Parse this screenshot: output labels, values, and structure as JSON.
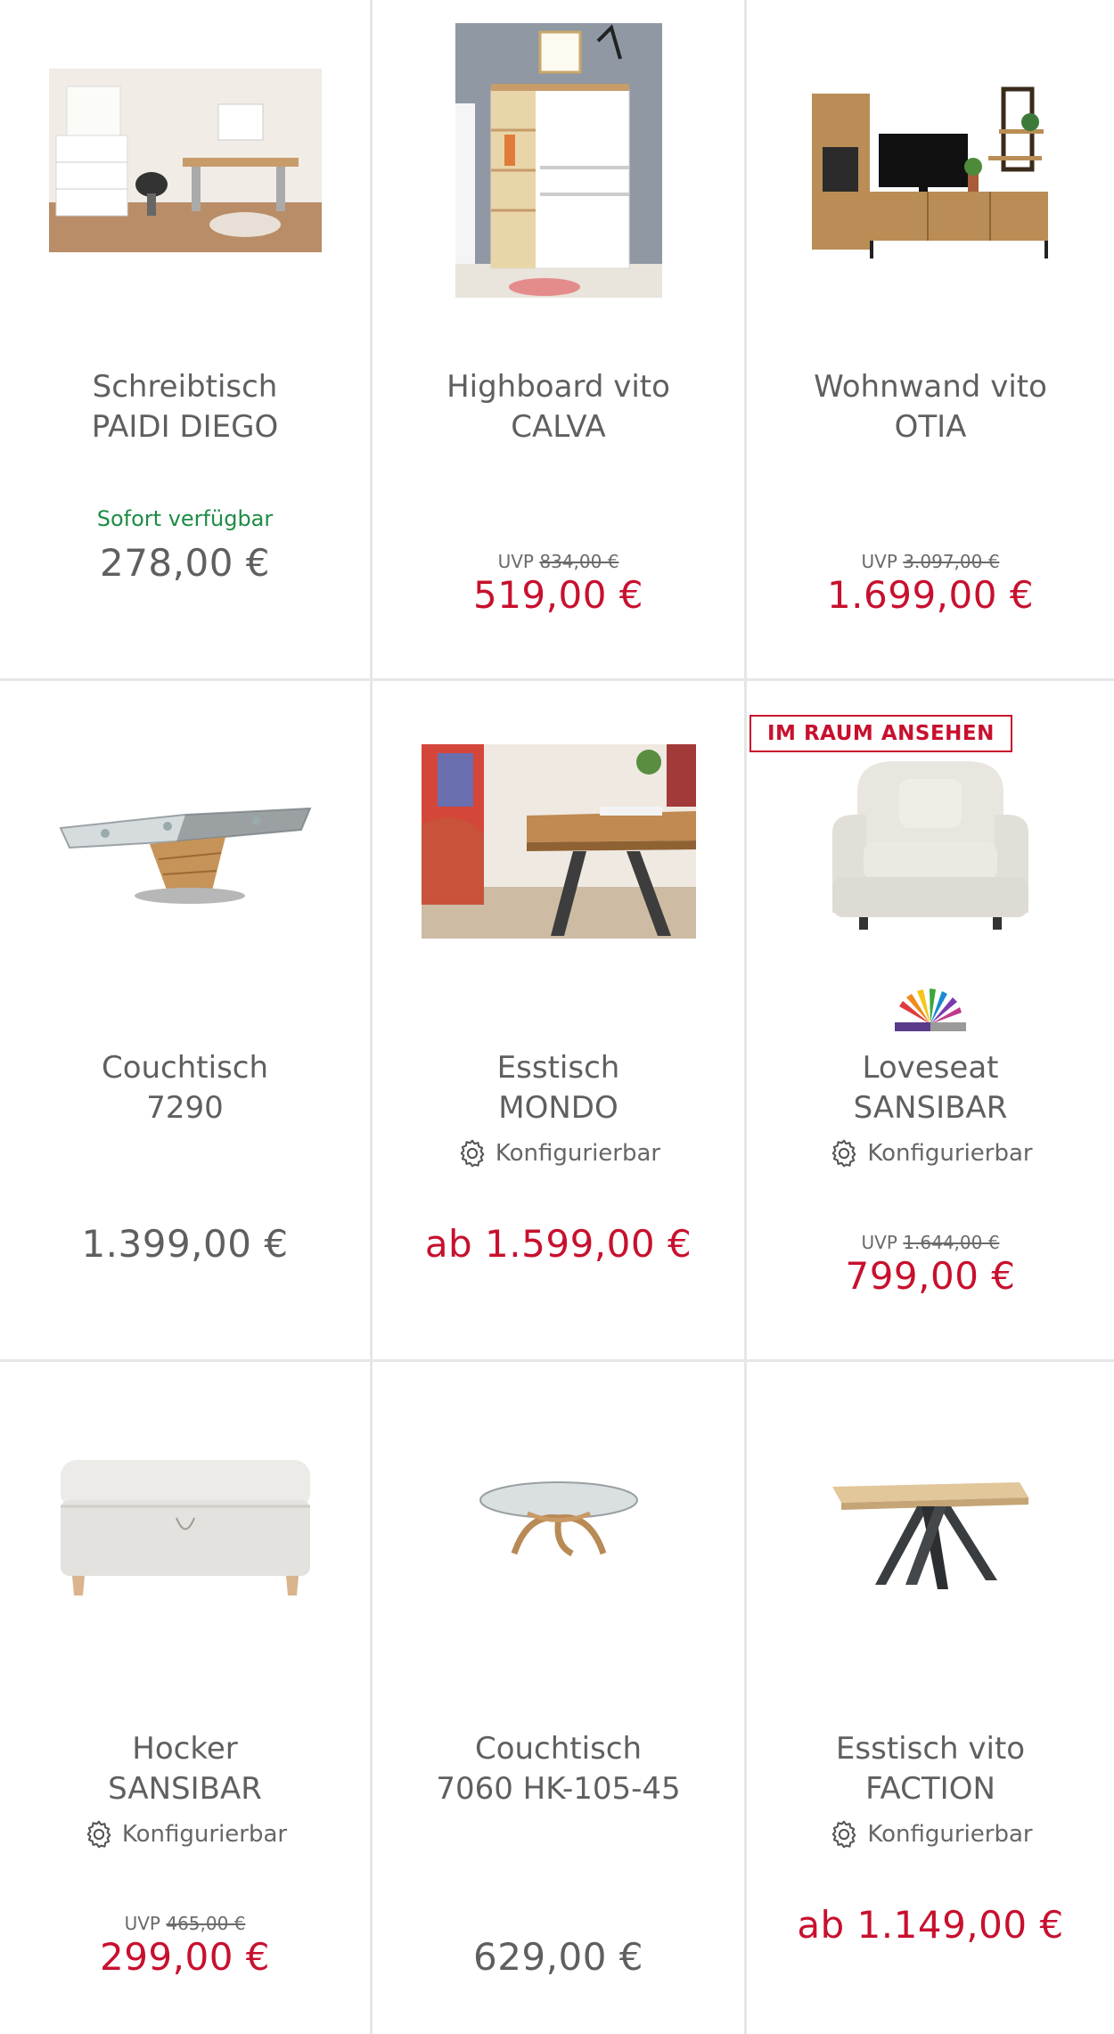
{
  "products": [
    {
      "title_line1": "Schreibtisch",
      "title_line2": "PAIDI DIEGO",
      "availability": "Sofort verfügbar",
      "price": "278,00 €",
      "image": "desk-room-photo"
    },
    {
      "title_line1": "Highboard vito",
      "title_line2": "CALVA",
      "uvp_label": "UVP",
      "uvp_price": "834,00 €",
      "price": "519,00 €",
      "image": "highboard-photo"
    },
    {
      "title_line1": "Wohnwand vito",
      "title_line2": "OTIA",
      "uvp_label": "UVP",
      "uvp_price": "3.097,00 €",
      "price": "1.699,00 €",
      "image": "wall-unit-photo"
    },
    {
      "title_line1": "Couchtisch",
      "title_line2": "7290",
      "price": "1.399,00 €",
      "image": "glass-coffee-table-photo"
    },
    {
      "title_line1": "Esstisch",
      "title_line2": "MONDO",
      "config_label": "Konfigurierbar",
      "price": "ab 1.599,00 €",
      "image": "dining-table-photo"
    },
    {
      "badge": "IM RAUM ANSEHEN",
      "title_line1": "Loveseat",
      "title_line2": "SANSIBAR",
      "config_label": "Konfigurierbar",
      "uvp_label": "UVP",
      "uvp_price": "1.644,00 €",
      "price": "799,00 €",
      "image": "loveseat-photo",
      "brand_logo": "color-fan-logo"
    },
    {
      "title_line1": "Hocker",
      "title_line2": "SANSIBAR",
      "config_label": "Konfigurierbar",
      "uvp_label": "UVP",
      "uvp_price": "465,00 €",
      "price": "299,00 €",
      "image": "ottoman-photo"
    },
    {
      "title_line1": "Couchtisch",
      "title_line2": "7060 HK-105-45",
      "price": "629,00 €",
      "image": "round-glass-table-photo"
    },
    {
      "title_line1": "Esstisch vito",
      "title_line2": "FACTION",
      "config_label": "Konfigurierbar",
      "price": "ab 1.149,00 €",
      "image": "faction-table-photo"
    }
  ],
  "colors": {
    "sale_red": "#c8102e",
    "available_green": "#1e8c45",
    "text_gray": "#5f5f5f",
    "divider": "#e6e6e6"
  }
}
